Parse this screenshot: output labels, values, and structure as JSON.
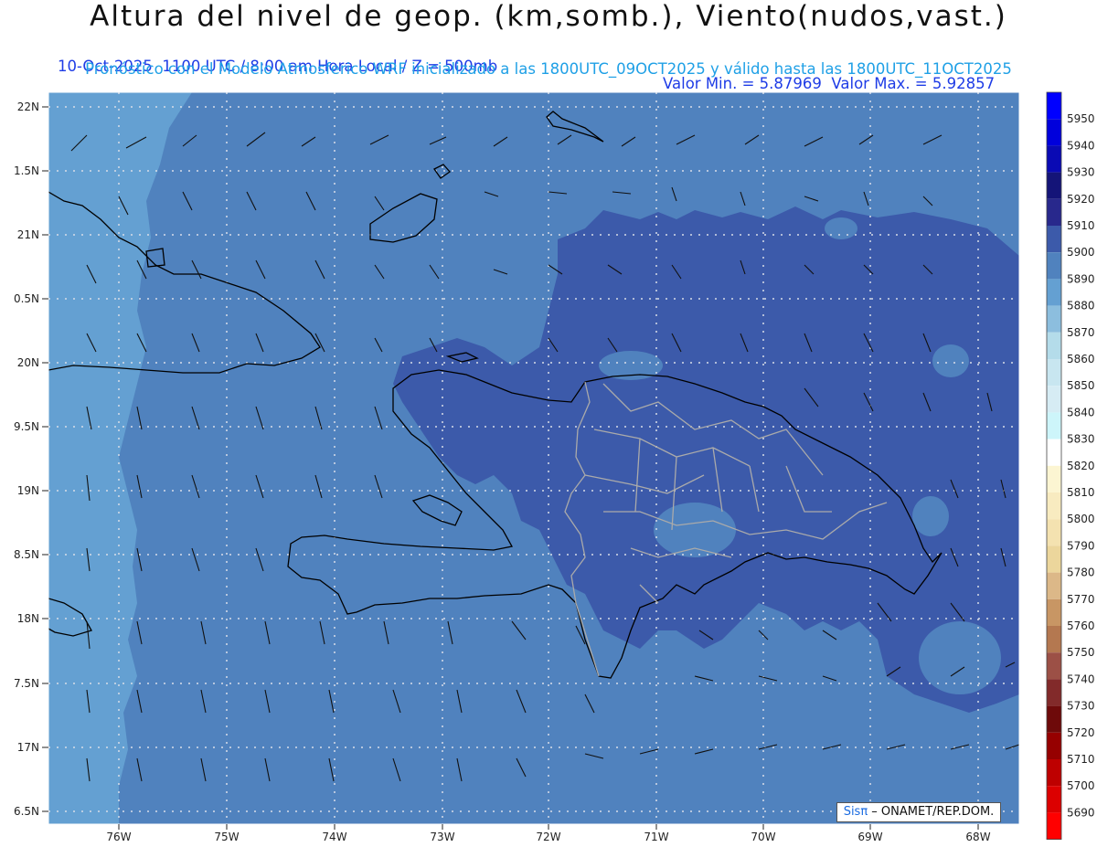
{
  "header": {
    "title": "Altura del nivel de geop. (km,somb.), Viento(nudos,vast.)",
    "date_time": "10-Oct-2025  1100 UTC / 8:00 am Hora Local / Z = 500mb",
    "min_max": "Valor Min. = 5.87969  Valor Max. = 5.92857",
    "model_info": "Pronóstico con el Modelo Atmosferico WRF inicializado a las 1800UTC_09OCT2025 y válido hasta las  1800UTC_11OCT2025"
  },
  "axes": {
    "lat_labels": [
      "22N",
      "1.5N",
      "21N",
      "0.5N",
      "20N",
      "9.5N",
      "19N",
      "8.5N",
      "18N",
      "7.5N",
      "17N",
      "6.5N"
    ],
    "lon_labels": [
      "76W",
      "75W",
      "74W",
      "73W",
      "72W",
      "71W",
      "70W",
      "69W",
      "68W"
    ]
  },
  "colorbar": {
    "levels": [
      {
        "label": "5950",
        "color": "#0000ff"
      },
      {
        "label": "5940",
        "color": "#0000dc"
      },
      {
        "label": "5930",
        "color": "#0a0ab4"
      },
      {
        "label": "5920",
        "color": "#141478"
      },
      {
        "label": "5910",
        "color": "#28288c"
      },
      {
        "label": "5900",
        "color": "#3c5aaa"
      },
      {
        "label": "5890",
        "color": "#5082be"
      },
      {
        "label": "5880",
        "color": "#64a0d2"
      },
      {
        "label": "5870",
        "color": "#8cbede"
      },
      {
        "label": "5860",
        "color": "#b4dcea"
      },
      {
        "label": "5850",
        "color": "#c8e6f0"
      },
      {
        "label": "5840",
        "color": "#d6ecf4"
      },
      {
        "label": "5830",
        "color": "#cdf5fa"
      },
      {
        "label": "5820",
        "color": "#ffffff"
      },
      {
        "label": "5810",
        "color": "#fcf5d2"
      },
      {
        "label": "5800",
        "color": "#f8ebc0"
      },
      {
        "label": "5790",
        "color": "#f4e2b0"
      },
      {
        "label": "5780",
        "color": "#ecd69c"
      },
      {
        "label": "5770",
        "color": "#dcb888"
      },
      {
        "label": "5760",
        "color": "#c89664"
      },
      {
        "label": "5750",
        "color": "#b47850"
      },
      {
        "label": "5740",
        "color": "#9c5046"
      },
      {
        "label": "5730",
        "color": "#822a2a"
      },
      {
        "label": "5720",
        "color": "#6e0a0a"
      },
      {
        "label": "5710",
        "color": "#960000"
      },
      {
        "label": "5700",
        "color": "#be0000"
      },
      {
        "label": "5690",
        "color": "#dc0000"
      },
      {
        "label": "",
        "color": "#ff0000"
      }
    ]
  },
  "field_colors": {
    "c5880": "#64a0d2",
    "c5890": "#5082be",
    "c5900": "#3c5aaa",
    "coast": "#000000",
    "borders": "#aaaaaa"
  },
  "credit": {
    "prefix": "Sisπ",
    "suffix": " – ONAMET/REP.DOM."
  }
}
